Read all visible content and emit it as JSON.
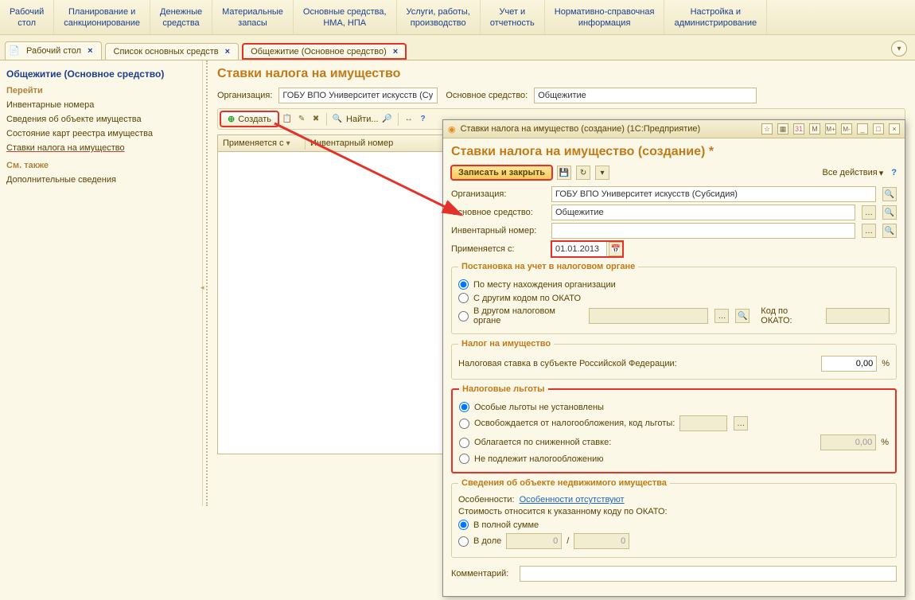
{
  "nav": [
    "Рабочий\nстол",
    "Планирование и\nсанкционирование",
    "Денежные\nсредства",
    "Материальные\nзапасы",
    "Основные средства,\nНМА, НПА",
    "Услуги, работы,\nпроизводство",
    "Учет и\nотчетность",
    "Нормативно-справочная\nинформация",
    "Настройка и\nадминистрирование"
  ],
  "tabs": {
    "t1": "Рабочий стол",
    "t2": "Список основных средств",
    "t3": "Общежитие (Основное средство)"
  },
  "side": {
    "title": "Общежитие (Основное средство)",
    "go": "Перейти",
    "links": [
      "Инвентарные номера",
      "Сведения об объекте имущества",
      "Состояние карт реестра имущества",
      "Ставки налога на имущество"
    ],
    "see": "См. также",
    "extra": "Дополнительные сведения"
  },
  "content": {
    "title": "Ставки налога на имущество",
    "org_lbl": "Организация:",
    "org_val": "ГОБУ ВПО Университет искусств (Суб",
    "fa_lbl": "Основное средство:",
    "fa_val": "Общежитие",
    "create": "Создать",
    "find": "Найти...",
    "col1": "Применяется с",
    "col2": "Инвентарный номер"
  },
  "modal": {
    "wintitle": "Ставки налога на имущество (создание)   (1С:Предприятие)",
    "heading": "Ставки налога на имущество (создание) *",
    "save": "Записать и закрыть",
    "actions": "Все действия",
    "org_lbl": "Организация:",
    "org_val": "ГОБУ ВПО Университет искусств (Субсидия)",
    "fa_lbl": "Основное средство:",
    "fa_val": "Общежитие",
    "inv_lbl": "Инвентарный номер:",
    "date_lbl": "Применяется с:",
    "date_val": "01.01.2013",
    "fs_reg": "Постановка на учет в налоговом органе",
    "r1": "По месту нахождения организации",
    "r2": "С другим кодом по ОКАТО",
    "r3": "В другом налоговом органе",
    "okato": "Код по ОКАТО:",
    "fs_tax": "Налог на имущество",
    "rate_lbl": "Налоговая ставка в субъекте Российской Федерации:",
    "rate_val": "0,00",
    "fs_ben": "Налоговые льготы",
    "b1": "Особые льготы не установлены",
    "b2": "Освобождается от налогообложения, код льготы:",
    "b3": "Облагается по сниженной ставке:",
    "b3v": "0,00",
    "b4": "Не подлежит налогообложению",
    "fs_obj": "Сведения об объекте недвижимого имущества",
    "feat": "Особенности:",
    "feat_link": "Особенности отсутствуют",
    "cost": "Стоимость относится к указанному коду по ОКАТО:",
    "c1": "В полной сумме",
    "c2": "В доле",
    "slash": "/",
    "zero": "0",
    "comment": "Комментарий:",
    "pct": "%"
  }
}
